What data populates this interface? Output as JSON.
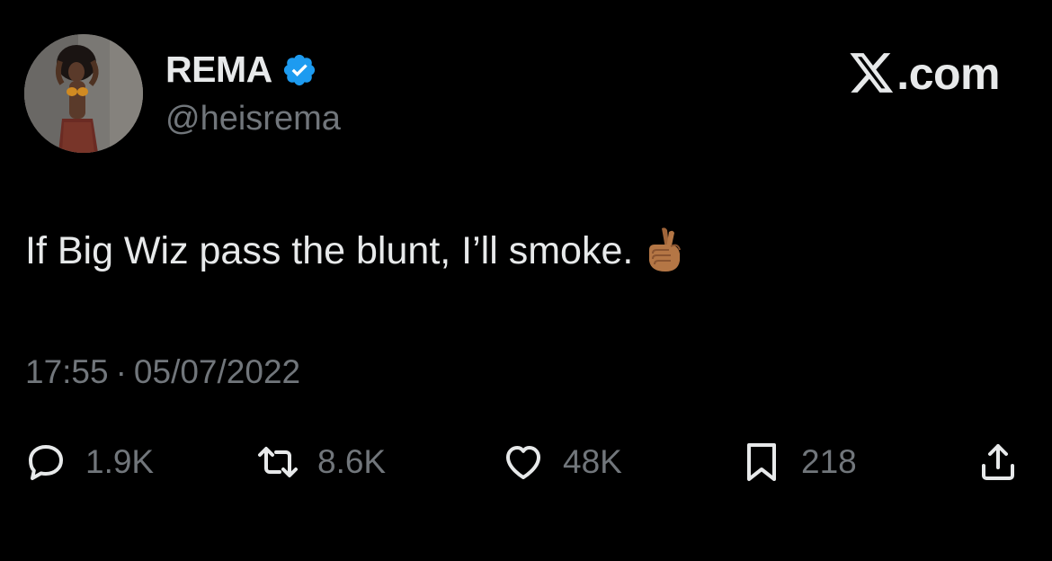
{
  "author": {
    "name": "REMA",
    "handle": "@heisrema",
    "verified": true,
    "avatar_icon": "profile-photo"
  },
  "brand": {
    "text": ".com",
    "logo_icon": "x-logo-icon"
  },
  "tweet": {
    "text": "If Big Wiz pass the blunt, I’ll smoke.",
    "emoji_icon": "crossed-fingers-emoji"
  },
  "meta": {
    "time": "17:55",
    "separator": "·",
    "date": "05/07/2022"
  },
  "actions": {
    "replies": "1.9K",
    "reposts": "8.6K",
    "likes": "48K",
    "bookmarks": "218"
  },
  "colors": {
    "background": "#000000",
    "primary_text": "#e7e9ea",
    "secondary_text": "#71767b",
    "verified_blue": "#1d9bf0"
  }
}
